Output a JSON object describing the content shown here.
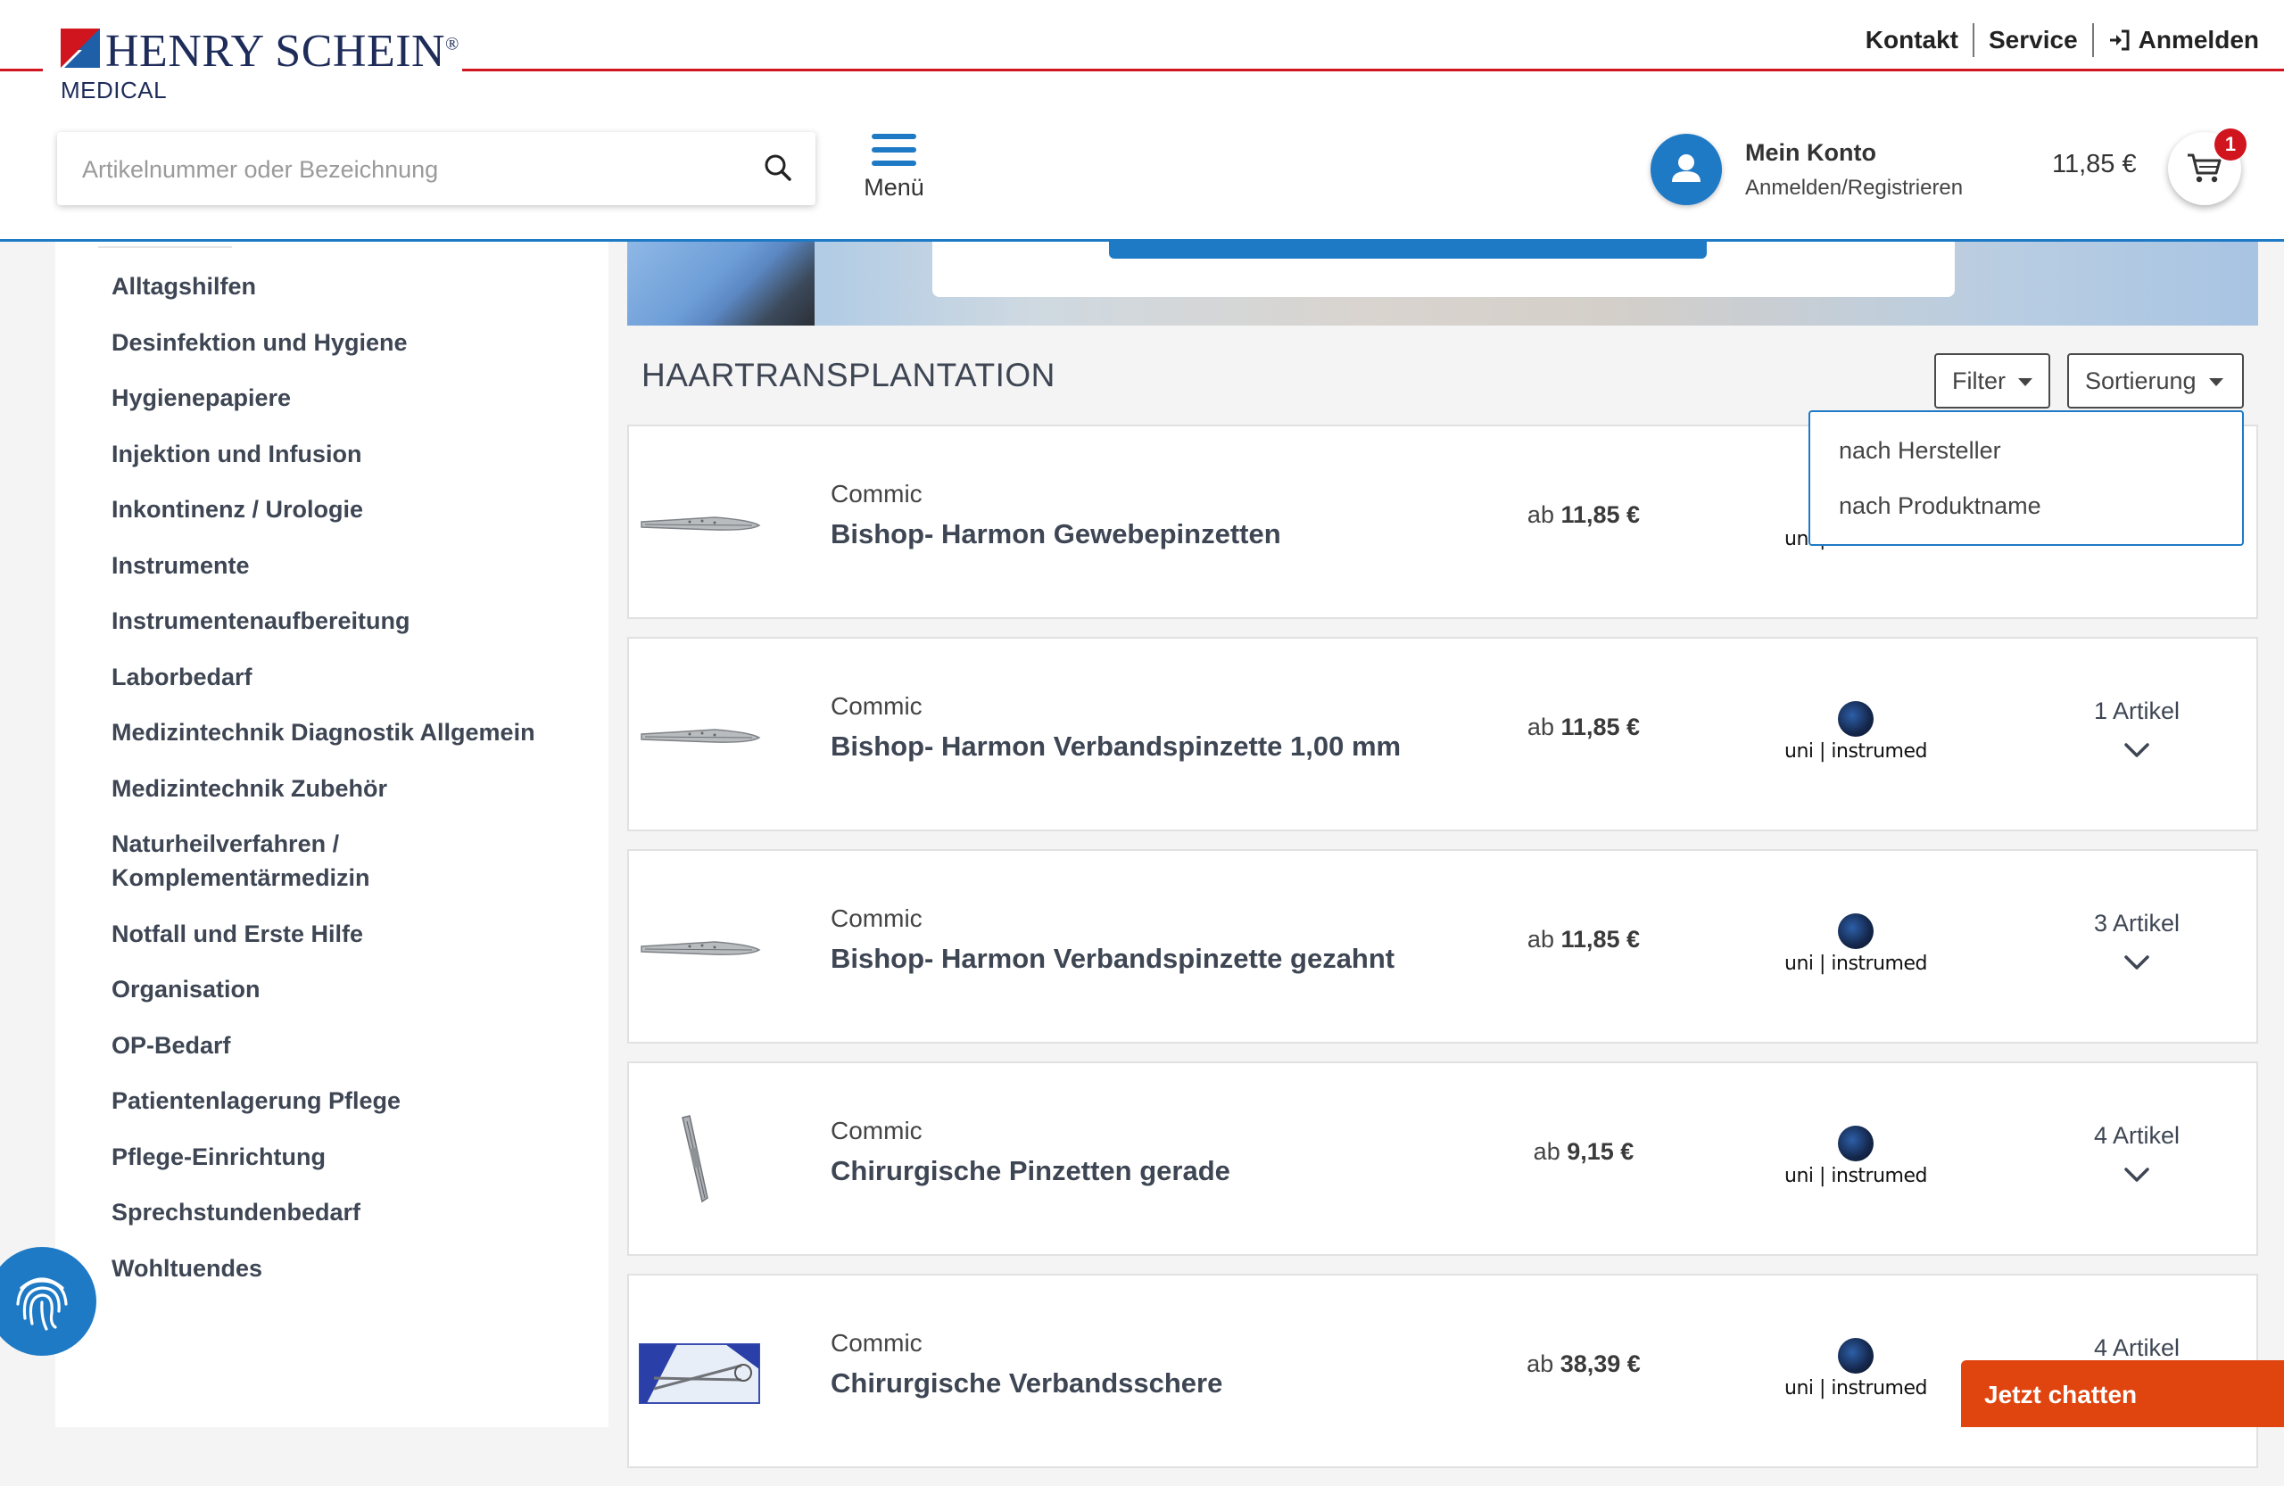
{
  "header": {
    "logo_text": "HENRY SCHEIN",
    "logo_reg": "®",
    "logo_sub": "MEDICAL",
    "toplinks": {
      "kontakt": "Kontakt",
      "service": "Service",
      "login": "Anmelden"
    },
    "search": {
      "placeholder": "Artikelnummer oder Bezeichnung",
      "value": ""
    },
    "menu_label": "Menü",
    "account": {
      "title": "Mein Konto",
      "subtitle": "Anmelden/Registrieren"
    },
    "cart": {
      "total": "11,85 €",
      "count": "1"
    },
    "colors": {
      "accent": "#1f7ac6",
      "brand_red": "#d0151e",
      "chat": "#e0440f"
    }
  },
  "sidebar": {
    "items": [
      "Alltagshilfen",
      "Desinfektion und Hygiene",
      "Hygienepapiere",
      "Injektion und Infusion",
      "Inkontinenz / Urologie",
      "Instrumente",
      "Instrumentenaufbereitung",
      "Laborbedarf",
      "Medizintechnik Diagnostik Allgemein",
      "Medizintechnik Zubehör",
      "Naturheilverfahren / Komplementärmedizin",
      "Notfall und Erste Hilfe",
      "Organisation",
      "OP-Bedarf",
      "Patientenlagerung Pflege",
      "Pflege-Einrichtung",
      "Sprechstundenbedarf",
      "Wohltuendes"
    ]
  },
  "main": {
    "section_title": "HAARTRANSPLANTATION",
    "filter_label": "Filter",
    "sort_label": "Sortierung",
    "sort_options": [
      "nach Hersteller",
      "nach Produktname"
    ],
    "price_prefix": "ab",
    "products": [
      {
        "brand": "Commic",
        "name": "Bishop- Harmon Gewebepinzetten",
        "price": "11,85 €",
        "manufacturer": "uni | instrumed",
        "count": "",
        "thumb": "forceps-icon"
      },
      {
        "brand": "Commic",
        "name": "Bishop- Harmon Verbandspinzette 1,00 mm",
        "price": "11,85 €",
        "manufacturer": "uni | instrumed",
        "count": "1 Artikel",
        "thumb": "forceps-icon"
      },
      {
        "brand": "Commic",
        "name": "Bishop- Harmon Verbandspinzette gezahnt",
        "price": "11,85 €",
        "manufacturer": "uni | instrumed",
        "count": "3 Artikel",
        "thumb": "forceps-icon"
      },
      {
        "brand": "Commic",
        "name": "Chirurgische Pinzetten gerade",
        "price": "9,15 €",
        "manufacturer": "uni | instrumed",
        "count": "4 Artikel",
        "thumb": "tweezers-icon"
      },
      {
        "brand": "Commic",
        "name": "Chirurgische Verbandsschere",
        "price": "38,39 €",
        "manufacturer": "uni | instrumed",
        "count": "4 Artikel",
        "thumb": "scissors-package-icon"
      }
    ]
  },
  "chat": {
    "label": "Jetzt chatten"
  }
}
